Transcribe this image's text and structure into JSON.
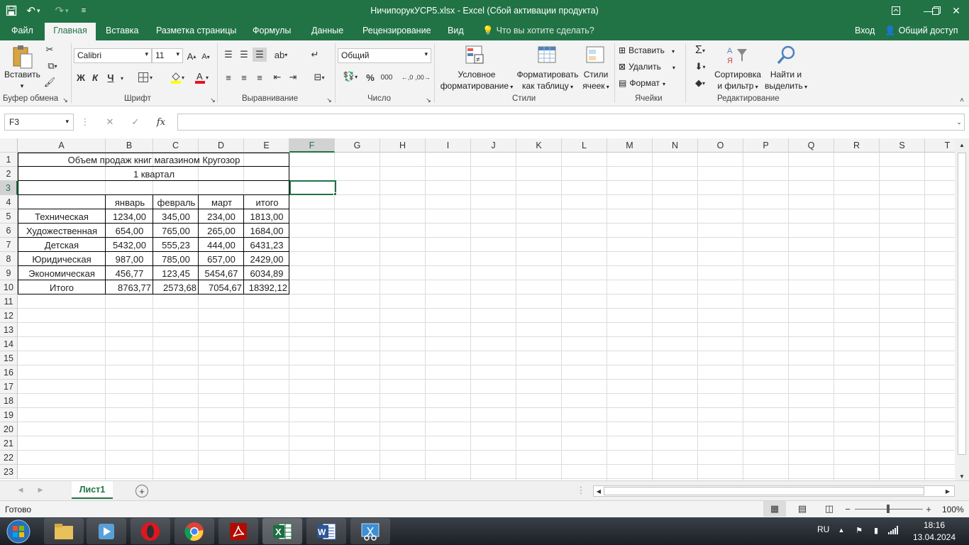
{
  "titlebar": {
    "title": "НичипорукУСР5.xlsx - Excel (Сбой активации продукта)"
  },
  "tabs": {
    "file": "Файл",
    "home": "Главная",
    "insert": "Вставка",
    "page_layout": "Разметка страницы",
    "formulas": "Формулы",
    "data": "Данные",
    "review": "Рецензирование",
    "view": "Вид",
    "tell_me": "Что вы хотите сделать?",
    "signin": "Вход",
    "share": "Общий доступ"
  },
  "ribbon": {
    "clipboard": {
      "paste": "Вставить",
      "group": "Буфер обмена"
    },
    "font": {
      "name": "Calibri",
      "size": "11",
      "bold": "Ж",
      "italic": "К",
      "underline": "Ч",
      "group": "Шрифт"
    },
    "alignment": {
      "group": "Выравнивание"
    },
    "number": {
      "format": "Общий",
      "percent": "%",
      "thousands": "000",
      "group": "Число"
    },
    "styles": {
      "conditional_1": "Условное",
      "conditional_2": "форматирование",
      "table_1": "Форматировать",
      "table_2": "как таблицу",
      "cell_1": "Стили",
      "cell_2": "ячеек",
      "group": "Стили"
    },
    "cells": {
      "insert": "Вставить",
      "delete": "Удалить",
      "format": "Формат",
      "group": "Ячейки"
    },
    "editing": {
      "sort_1": "Сортировка",
      "sort_2": "и фильтр",
      "find_1": "Найти и",
      "find_2": "выделить",
      "group": "Редактирование"
    }
  },
  "formula_bar": {
    "name_box": "F3",
    "fx": "fx",
    "value": ""
  },
  "grid": {
    "columns": [
      "A",
      "B",
      "C",
      "D",
      "E",
      "F",
      "G",
      "H",
      "I",
      "J",
      "K",
      "L",
      "M",
      "N",
      "O",
      "P",
      "Q",
      "R",
      "S",
      "T"
    ],
    "rows": [
      "1",
      "2",
      "3",
      "4",
      "5",
      "6",
      "7",
      "8",
      "9",
      "10",
      "11",
      "12",
      "13",
      "14",
      "15",
      "16",
      "17",
      "18",
      "19",
      "20",
      "21",
      "22",
      "23"
    ],
    "title": "Объем продаж книг магазином Кругозор",
    "subtitle": "1 квартал",
    "headers": [
      "январь",
      "февраль",
      "март",
      "итого"
    ],
    "table": [
      [
        "Техническая",
        "1234,00",
        "345,00",
        "234,00",
        "1813,00"
      ],
      [
        "Художественная",
        "654,00",
        "765,00",
        "265,00",
        "1684,00"
      ],
      [
        "Детская",
        "5432,00",
        "555,23",
        "444,00",
        "6431,23"
      ],
      [
        "Юридическая",
        "987,00",
        "785,00",
        "657,00",
        "2429,00"
      ],
      [
        "Экономическая",
        "456,77",
        "123,45",
        "5454,67",
        "6034,89"
      ],
      [
        "Итого",
        "8763,77",
        "2573,68",
        "7054,67",
        "18392,12"
      ]
    ]
  },
  "sheets": {
    "active": "Лист1"
  },
  "status": {
    "ready": "Готово",
    "zoom": "100%"
  },
  "taskbar": {
    "lang": "RU",
    "time": "18:16",
    "date": "13.04.2024"
  },
  "colors": {
    "excel_green": "#217346",
    "selection": "#217346"
  }
}
